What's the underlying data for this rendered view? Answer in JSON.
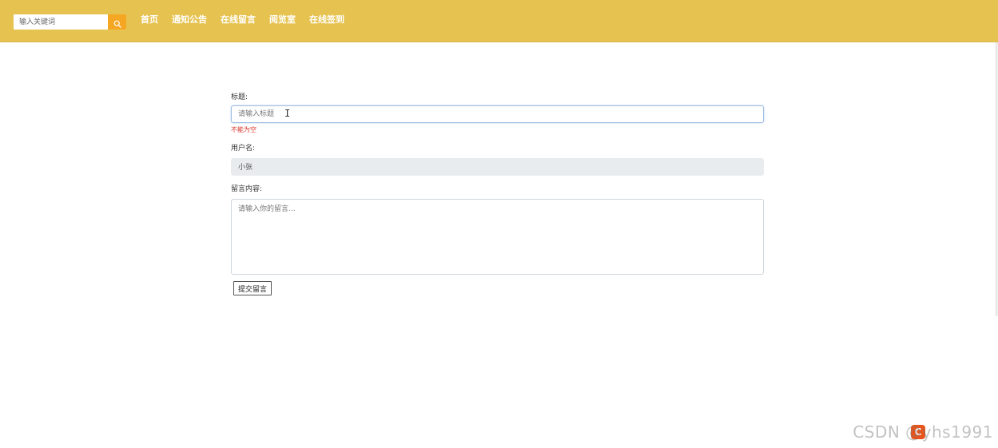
{
  "header": {
    "search": {
      "placeholder": "输入关键词",
      "icon": "search-icon"
    },
    "nav": [
      "首页",
      "通知公告",
      "在线留言",
      "阅览室",
      "在线签到"
    ]
  },
  "form": {
    "title_label": "标题:",
    "title_placeholder": "请输入标题",
    "title_error": "不能为空",
    "username_label": "用户名:",
    "username_value": "小张",
    "content_label": "留言内容:",
    "content_placeholder": "请输入你的留言...",
    "submit_label": "提交留言"
  },
  "watermark": "CSDN @yhs1991",
  "colors": {
    "header_bg": "#e6c350",
    "search_button": "#f5a623",
    "error": "#d9362b",
    "readonly_bg": "#e9ecef"
  }
}
